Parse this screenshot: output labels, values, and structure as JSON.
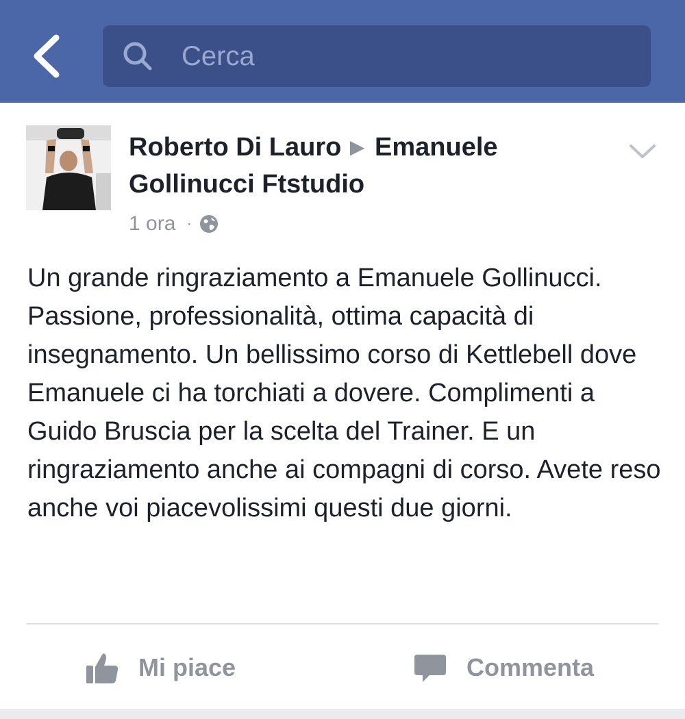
{
  "header": {
    "search_placeholder": "Cerca"
  },
  "post": {
    "author": "Roberto Di Lauro",
    "target": "Emanuele Gollinucci Ftstudio",
    "time": "1 ora",
    "separator": "·",
    "privacy_icon": "globe-icon",
    "text": "Un grande ringraziamento a Emanuele Gollinucci. Passione, professionalità, ottima capacità di insegnamento. Un bellissimo corso di Kettlebell dove Emanuele ci ha torchiati a dovere. Complimenti a Guido Bruscia per la scelta del Trainer. E un ringraziamento anche ai compagni di corso. Avete reso anche voi piacevolissimi questi due giorni."
  },
  "actions": {
    "like_label": "Mi piace",
    "comment_label": "Commenta"
  },
  "colors": {
    "header_bg": "#4b67a7",
    "search_bg": "#3b5088",
    "text": "#1d2129",
    "muted": "#90949c"
  }
}
